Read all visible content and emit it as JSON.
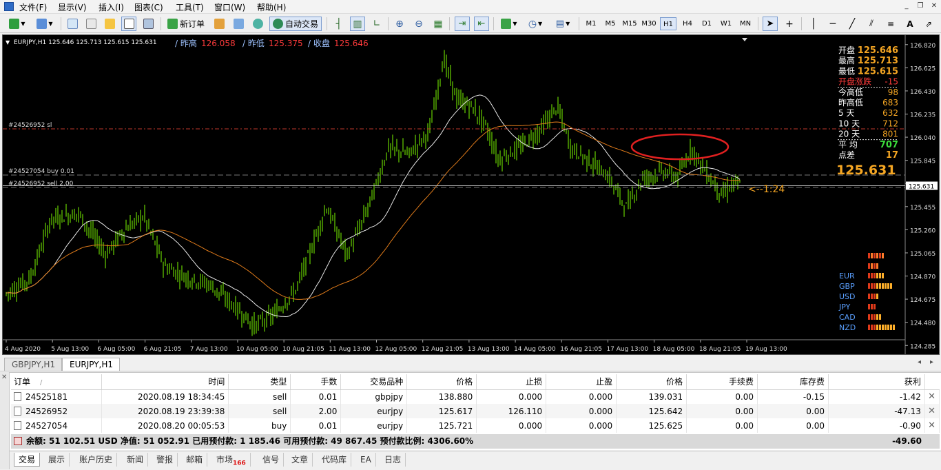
{
  "menubar": {
    "items": [
      "文件(F)",
      "显示(V)",
      "插入(I)",
      "图表(C)",
      "工具(T)",
      "窗口(W)",
      "帮助(H)"
    ]
  },
  "toolbar": {
    "new_order": "新订单",
    "auto_trading": "自动交易",
    "timeframes": [
      "M1",
      "M5",
      "M15",
      "M30",
      "H1",
      "H4",
      "D1",
      "W1",
      "MN"
    ],
    "active_timeframe": "H1"
  },
  "chart": {
    "header": "EURJPY,H1  125.646 125.713 125.615 125.631",
    "yday_high_label": "/ 昨高",
    "yday_high_value": "126.058",
    "yday_low_label": "/ 昨低",
    "yday_low_value": "125.375",
    "close_label": "/ 收盘",
    "close_value": "125.646",
    "order_lines": [
      {
        "label": "#24526952 sl",
        "price": 126.11,
        "color": "#c0392b"
      },
      {
        "label": "#24527054 buy 0.01",
        "price": 125.721,
        "color": "#777777"
      },
      {
        "label": "#24526952 sell 2.00",
        "price": 125.617,
        "color": "#777777"
      }
    ],
    "current_price": "125.631",
    "big_price": "125.631",
    "countdown": "<--1:24",
    "info_panel": [
      {
        "label": "开盘",
        "value": "125.646"
      },
      {
        "label": "最高",
        "value": "125.713"
      },
      {
        "label": "最低",
        "value": "125.615"
      },
      {
        "label": "开盘涨跌",
        "value": "-15"
      },
      {
        "label": "今高低",
        "value": "98"
      },
      {
        "label": "昨高低",
        "value": "683"
      },
      {
        "label": "5   天",
        "value": "632"
      },
      {
        "label": "10  天",
        "value": "712"
      },
      {
        "label": "20  天",
        "value": "801"
      },
      {
        "label": "平  均",
        "value": "707"
      },
      {
        "label": "点差",
        "value": "17"
      }
    ],
    "currency_strength": [
      {
        "name": "EUR",
        "bars": 6
      },
      {
        "name": "GBP",
        "bars": 9
      },
      {
        "name": "USD",
        "bars": 4
      },
      {
        "name": "JPY",
        "bars": 3
      },
      {
        "name": "CAD",
        "bars": 5
      },
      {
        "name": "NZD",
        "bars": 10
      }
    ],
    "y_axis_ticks": [
      "126.820",
      "126.625",
      "126.430",
      "126.235",
      "126.040",
      "125.845",
      "125.650",
      "125.455",
      "125.260",
      "125.065",
      "124.870",
      "124.675",
      "124.480",
      "124.285"
    ],
    "x_axis_ticks": [
      "4 Aug 2020",
      "5 Aug 13:00",
      "6 Aug 05:00",
      "6 Aug 21:05",
      "7 Aug 13:00",
      "10 Aug 05:00",
      "10 Aug 21:05",
      "11 Aug 13:00",
      "12 Aug 05:00",
      "12 Aug 21:05",
      "13 Aug 13:00",
      "14 Aug 05:00",
      "16 Aug 21:05",
      "17 Aug 13:00",
      "18 Aug 05:00",
      "18 Aug 21:05",
      "19 Aug 13:00"
    ],
    "colors": {
      "candle": "#7cfc00",
      "ma_fast": "#e8e8e8",
      "ma_slow": "#e07b1a",
      "sl_line": "#c0392b",
      "highlight_ellipse": "#e02020",
      "value_orange": "#f5a623",
      "value_red": "#ff3b3b"
    }
  },
  "chart_tabs": [
    "GBPJPY,H1",
    "EURJPY,H1"
  ],
  "active_chart_tab": "EURJPY,H1",
  "orders_table": {
    "columns": [
      "订单",
      "时间",
      "类型",
      "手数",
      "交易品种",
      "价格",
      "止损",
      "止盈",
      "价格",
      "手续费",
      "库存费",
      "获利"
    ],
    "rows": [
      [
        "24525181",
        "2020.08.19 18:34:45",
        "sell",
        "0.01",
        "gbpjpy",
        "138.880",
        "0.000",
        "0.000",
        "139.031",
        "0.00",
        "-0.15",
        "-1.42"
      ],
      [
        "24526952",
        "2020.08.19 23:39:38",
        "sell",
        "2.00",
        "eurjpy",
        "125.617",
        "126.110",
        "0.000",
        "125.642",
        "0.00",
        "0.00",
        "-47.13"
      ],
      [
        "24527054",
        "2020.08.20 00:05:53",
        "buy",
        "0.01",
        "eurjpy",
        "125.721",
        "0.000",
        "0.000",
        "125.625",
        "0.00",
        "0.00",
        "-0.90"
      ]
    ]
  },
  "summary": {
    "text": "余额: 51 102.51 USD  净值: 51 052.91  已用预付款: 1 185.46  可用预付款: 49 867.45  预付款比例: 4306.60%",
    "total": "-49.60"
  },
  "bottom_tabs": [
    "交易",
    "展示",
    "账户历史",
    "新闻",
    "警报",
    "邮箱",
    "市场",
    "信号",
    "文章",
    "代码库",
    "EA",
    "日志"
  ],
  "market_badge": "166",
  "active_bottom_tab": "交易"
}
